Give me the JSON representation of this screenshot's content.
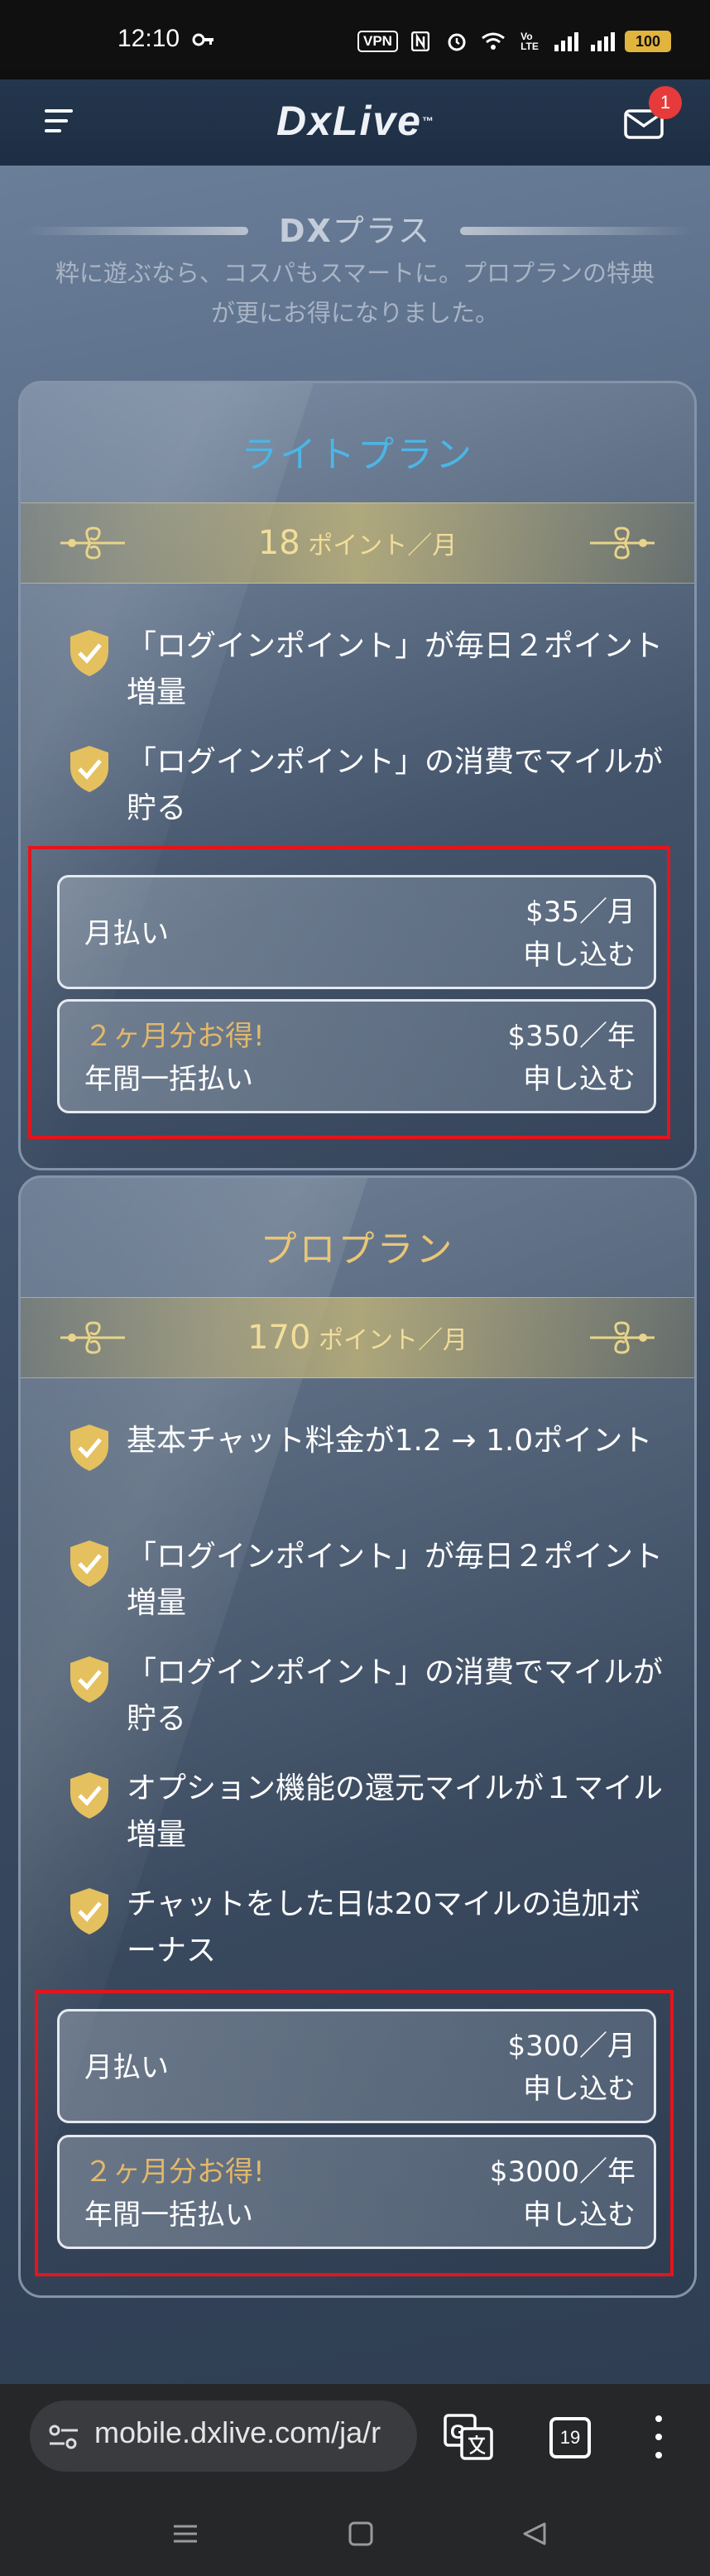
{
  "status_bar": {
    "time": "12:10",
    "vpn": "VPN",
    "battery": "100",
    "icons": [
      "key-icon",
      "vpn-badge",
      "nfc-icon",
      "alarm-icon",
      "wifi-icon",
      "volte-icon",
      "signal-icon",
      "signal-icon-2",
      "battery-icon"
    ]
  },
  "header": {
    "logo": "DxLive",
    "logo_tm": "™",
    "mail_badge": "1"
  },
  "section": {
    "title_dx": "DX",
    "title_rest": "プラス",
    "subtitle": "粋に遊ぶなら、コスパもスマートに。プロプランの特典が更にお得になりました。"
  },
  "plans": [
    {
      "name": "ライトプラン",
      "points_num": "18",
      "points_unit": " ポイント／月",
      "features": [
        "「ログインポイント」が毎日２ポイント増量",
        "「ログインポイント」の消費でマイルが貯る"
      ],
      "monthly": {
        "label": "月払い",
        "price": "$35／月",
        "apply": "申し込む"
      },
      "yearly": {
        "promo": "２ヶ月分お得!",
        "label": "年間一括払い",
        "price": "$350／年",
        "apply": "申し込む"
      }
    },
    {
      "name": "プロプラン",
      "points_num": "170",
      "points_unit": " ポイント／月",
      "features": [
        "基本チャット料金が1.2 → 1.0ポイント",
        "「ログインポイント」が毎日２ポイント増量",
        "「ログインポイント」の消費でマイルが貯る",
        "オプション機能の還元マイルが１マイル増量",
        "チャットをした日は20マイルの追加ボーナス"
      ],
      "monthly": {
        "label": "月払い",
        "price": "$300／月",
        "apply": "申し込む"
      },
      "yearly": {
        "promo": "２ヶ月分お得!",
        "label": "年間一括払い",
        "price": "$3000／年",
        "apply": "申し込む"
      }
    }
  ],
  "browser": {
    "url": "mobile.dxlive.com/ja/r",
    "tab_count": "19"
  },
  "colors": {
    "lite_title": "#4bb6e6",
    "pro_title": "#e9c676",
    "promo": "#e3b86a",
    "highlight_frame": "#e5141c"
  }
}
